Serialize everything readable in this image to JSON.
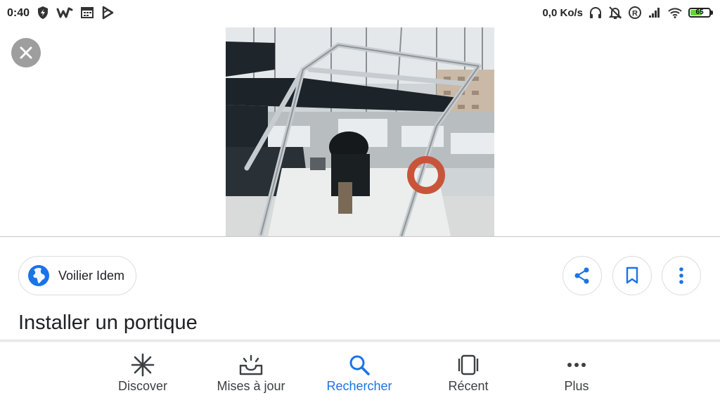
{
  "status_bar": {
    "time": "0:40",
    "network_speed": "0,0 Ko/s",
    "battery_level": "65"
  },
  "source": {
    "name": "Voilier Idem"
  },
  "result": {
    "title": "Installer un portique"
  },
  "bottom_nav": {
    "items": [
      {
        "label": "Discover",
        "icon": "asterisk-icon"
      },
      {
        "label": "Mises à jour",
        "icon": "updates-inbox-icon"
      },
      {
        "label": "Rechercher",
        "icon": "search-icon",
        "active": true
      },
      {
        "label": "Récent",
        "icon": "recent-cards-icon"
      },
      {
        "label": "Plus",
        "icon": "more-horizontal-icon"
      }
    ]
  },
  "colors": {
    "accent": "#1a73e8",
    "close_bg": "#9e9e9e",
    "battery": "#6ad03b"
  }
}
